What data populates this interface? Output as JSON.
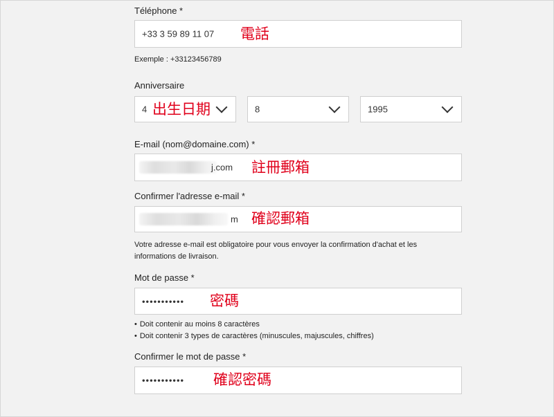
{
  "telephone": {
    "label": "Téléphone *",
    "value": "+33 3 59 89 11 07",
    "annotation": "電話",
    "example": "Exemple : +33123456789"
  },
  "birthday": {
    "label": "Anniversaire",
    "day": "4",
    "month": "8",
    "year": "1995",
    "annotation": "出生日期"
  },
  "email": {
    "label": "E-mail (nom@domaine.com) *",
    "value_suffix": "j.com",
    "annotation": "註冊郵箱"
  },
  "email_confirm": {
    "label": "Confirmer l'adresse e-mail *",
    "value_suffix": "m",
    "annotation": "確認郵箱",
    "help_line1": "Votre adresse e-mail est obligatoire pour vous envoyer la confirmation d'achat et les",
    "help_line2": "informations de livraison."
  },
  "password": {
    "label": "Mot de passe *",
    "value": "•••••••••••",
    "annotation": "密碼",
    "rules": [
      "Doit contenir au moins 8 caractères",
      "Doit contenir 3 types de caractères (minuscules, majuscules, chiffres)"
    ]
  },
  "password_confirm": {
    "label": "Confirmer le mot de passe *",
    "value": "•••••••••••",
    "annotation": "確認密碼"
  },
  "colors": {
    "annotation": "#e0001b",
    "background": "#f2f2f2",
    "field_border": "#cfcfcf"
  }
}
